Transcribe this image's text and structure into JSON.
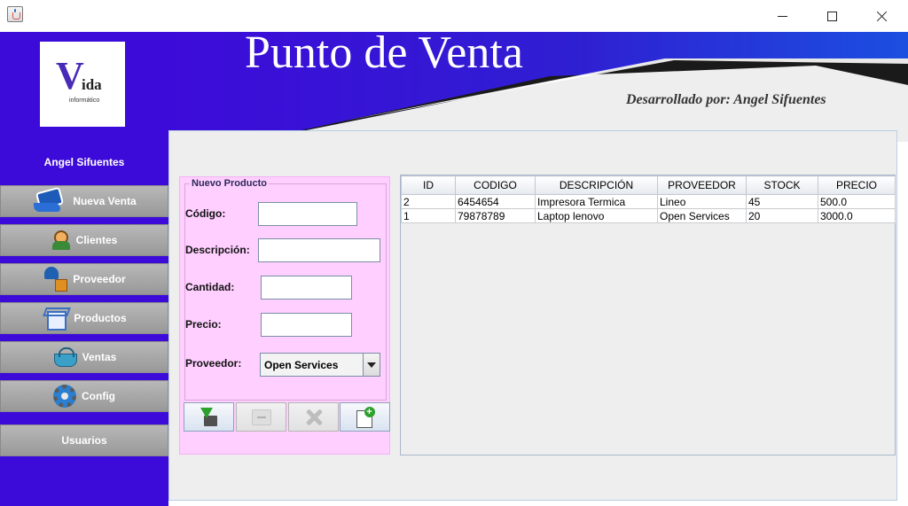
{
  "window": {
    "icon": "java-cup-icon",
    "controls": [
      "minimize-icon",
      "maximize-icon",
      "close-icon"
    ]
  },
  "sidebar": {
    "logo": {
      "initial": "V",
      "text": "ida",
      "subtext": "informático"
    },
    "user_name": "Angel Sifuentes",
    "items": [
      {
        "label": "Nueva Venta",
        "icon": "money-hand-icon"
      },
      {
        "label": "Clientes",
        "icon": "clients-icon"
      },
      {
        "label": "Proveedor",
        "icon": "delivery-person-icon"
      },
      {
        "label": "Productos",
        "icon": "box-icon"
      },
      {
        "label": "Ventas",
        "icon": "basket-icon"
      },
      {
        "label": "Config",
        "icon": "gear-icon"
      },
      {
        "label": "Usuarios",
        "icon": ""
      }
    ]
  },
  "header": {
    "title": "Punto de Venta",
    "credit": "Desarrollado por: Angel Sifuentes"
  },
  "form": {
    "legend": "Nuevo Producto",
    "fields": {
      "codigo": {
        "label": "Código:",
        "value": ""
      },
      "descripcion": {
        "label": "Descripción:",
        "value": ""
      },
      "cantidad": {
        "label": "Cantidad:",
        "value": ""
      },
      "precio": {
        "label": "Precio:",
        "value": ""
      }
    },
    "proveedor": {
      "label": "Proveedor:",
      "selected": "Open Services"
    },
    "buttons": [
      {
        "action": "save",
        "icon": "save-icon",
        "enabled": true
      },
      {
        "action": "edit",
        "icon": "edit-icon",
        "enabled": false
      },
      {
        "action": "delete",
        "icon": "delete-icon",
        "enabled": false
      },
      {
        "action": "new",
        "icon": "new-document-icon",
        "enabled": true
      }
    ]
  },
  "table": {
    "columns": [
      "ID",
      "CODIGO",
      "DESCRIPCIÓN",
      "PROVEEDOR",
      "STOCK",
      "PRECIO"
    ],
    "rows": [
      [
        "2",
        "6454654",
        "Impresora Termica",
        "Lineo",
        "45",
        "500.0"
      ],
      [
        "1",
        "79878789",
        "Laptop lenovo",
        "Open Services",
        "20",
        "3000.0"
      ]
    ]
  },
  "colors": {
    "sidebar": "#3d0bd9",
    "form_panel": "#ffcfff",
    "header_dark": "#1a1a1a",
    "header_blue": "#1b4fe0"
  }
}
